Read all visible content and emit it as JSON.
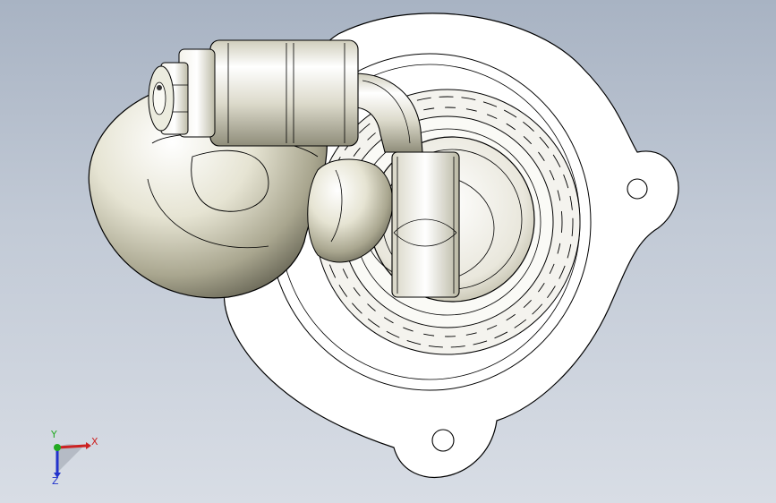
{
  "viewport": {
    "background_top": "#a8b3c3",
    "background_bottom": "#d8dde5",
    "model": "turbocharger-housing-assembly"
  },
  "triad": {
    "x_label": "X",
    "y_label": "Y",
    "z_label": "Z",
    "x_color": "#cc2222",
    "y_color": "#22aa22",
    "z_color": "#2233cc"
  }
}
